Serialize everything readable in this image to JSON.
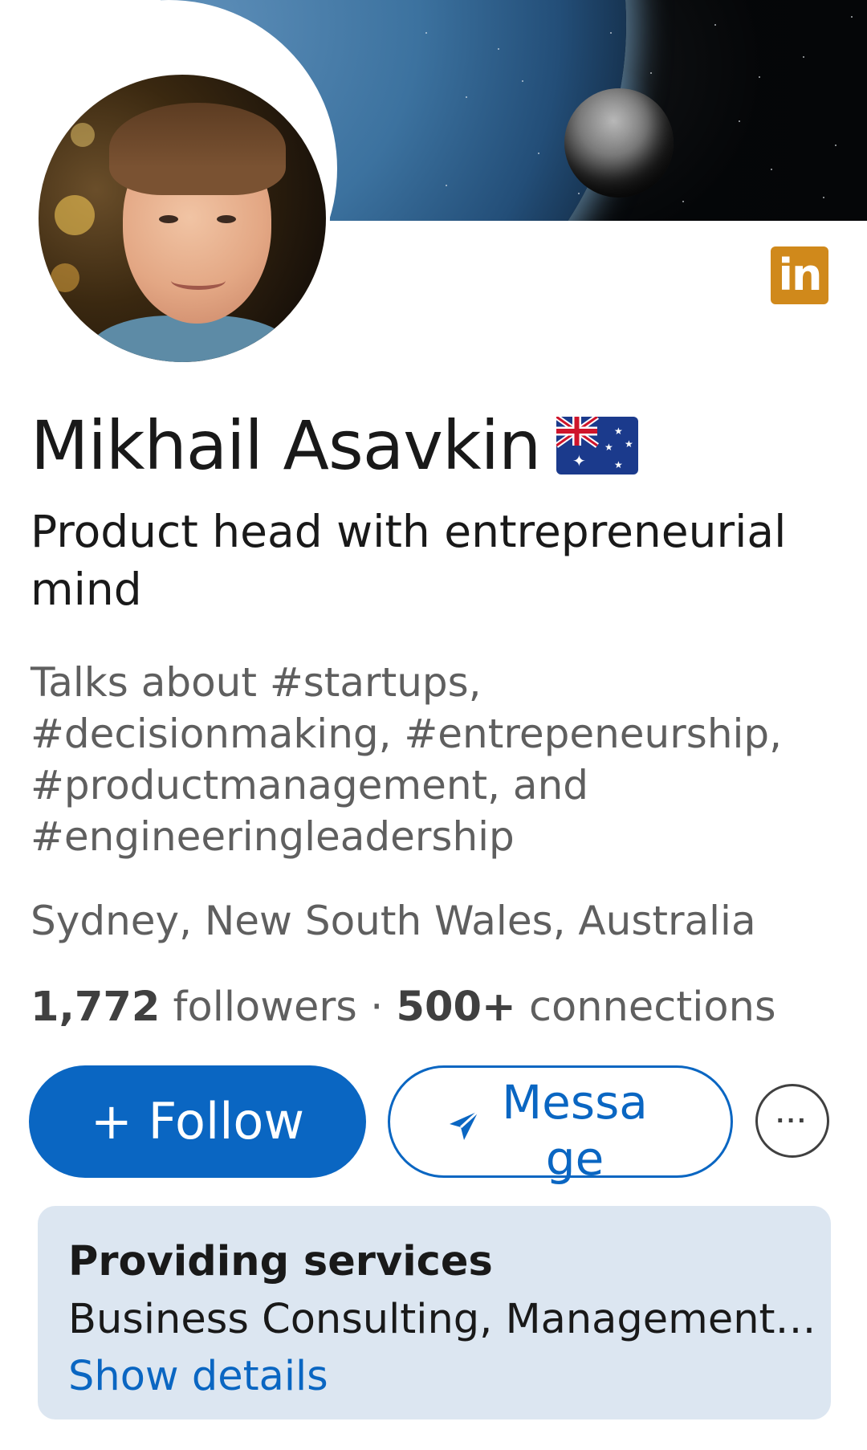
{
  "profile": {
    "name": "Mikhail Asavkin",
    "flag_icon": "australia-flag-icon",
    "headline": "Product head with entrepreneurial mind",
    "talks_about": "Talks about #startups, #decisionmaking, #entrepeneurship, #productmanagement, and #engineeringleadership",
    "location": "Sydney, New South Wales, Australia",
    "followers_count": "1,772",
    "followers_label": "followers",
    "separator": "·",
    "connections_count": "500+",
    "connections_label": "connections"
  },
  "badge": {
    "label": "in",
    "icon": "linkedin-icon",
    "color": "#d0891b"
  },
  "actions": {
    "follow_label": "+ Follow",
    "message_label": "Message",
    "message_icon": "send-icon",
    "more_label": "···",
    "more_icon": "more-icon"
  },
  "services": {
    "title": "Providing services",
    "list": "Business Consulting, Management Co...",
    "link_label": "Show details"
  },
  "colors": {
    "accent": "#0a66c2",
    "services_bg": "#dce6f1",
    "secondary_text": "#5f5f5f"
  }
}
